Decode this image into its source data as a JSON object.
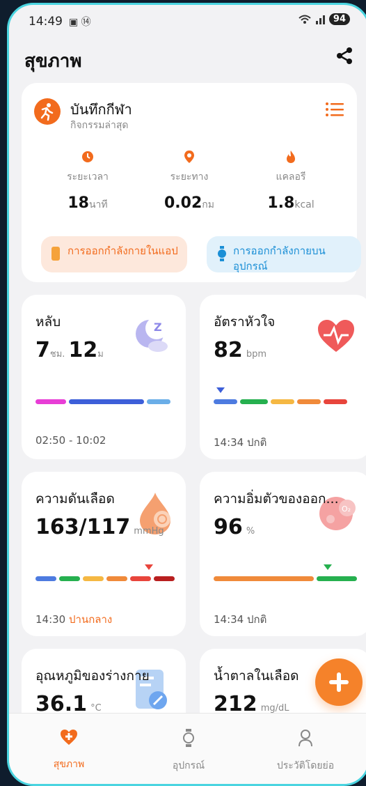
{
  "status": {
    "time": "14:49",
    "icons": "▣ ⑭",
    "battery": "94"
  },
  "header": {
    "title": "สุขภาพ"
  },
  "sport": {
    "title": "บันทึกกีฬา",
    "subtitle": "กิจกรรมล่าสุด",
    "metrics": [
      {
        "label": "ระยะเวลา",
        "value": "18",
        "unit": "นาที"
      },
      {
        "label": "ระยะทาง",
        "value": "0.02",
        "unit": "กม"
      },
      {
        "label": "แคลอรี",
        "value": "1.8",
        "unit": "kcal"
      }
    ],
    "btn_app": "การออกกำลังกายในแอป",
    "btn_device": "การออกกำลังกายบนอุปกรณ์"
  },
  "cards": {
    "sleep": {
      "title": "หลับ",
      "hours": "7",
      "hours_unit": "ชม.",
      "mins": "12",
      "mins_unit": "ม",
      "footer": "02:50 - 10:02"
    },
    "heart": {
      "title": "อัตราหัวใจ",
      "value": "82",
      "unit": "bpm",
      "footer": "14:34 ปกติ"
    },
    "bp": {
      "title": "ความดันเลือด",
      "value": "163/117",
      "unit": "mmHg",
      "footer_time": "14:30",
      "footer_status": "ปานกลาง"
    },
    "spo2": {
      "title": "ความอิ่มตัวของออก...",
      "value": "96",
      "unit": "%",
      "footer": "14:34 ปกติ"
    },
    "temp": {
      "title": "อุณหภูมิของร่างกาย",
      "value": "36.1",
      "unit": "°C"
    },
    "glucose": {
      "title": "น้ำตาลในเลือด",
      "value": "212",
      "unit": "mg/dL"
    }
  },
  "nav": [
    {
      "label": "สุขภาพ"
    },
    {
      "label": "อุปกรณ์"
    },
    {
      "label": "ประวัติโดยย่อ"
    }
  ],
  "colors": {
    "accent": "#f26b1d",
    "active_tab": "#f26b1d",
    "frame": "#4ad4e0"
  }
}
